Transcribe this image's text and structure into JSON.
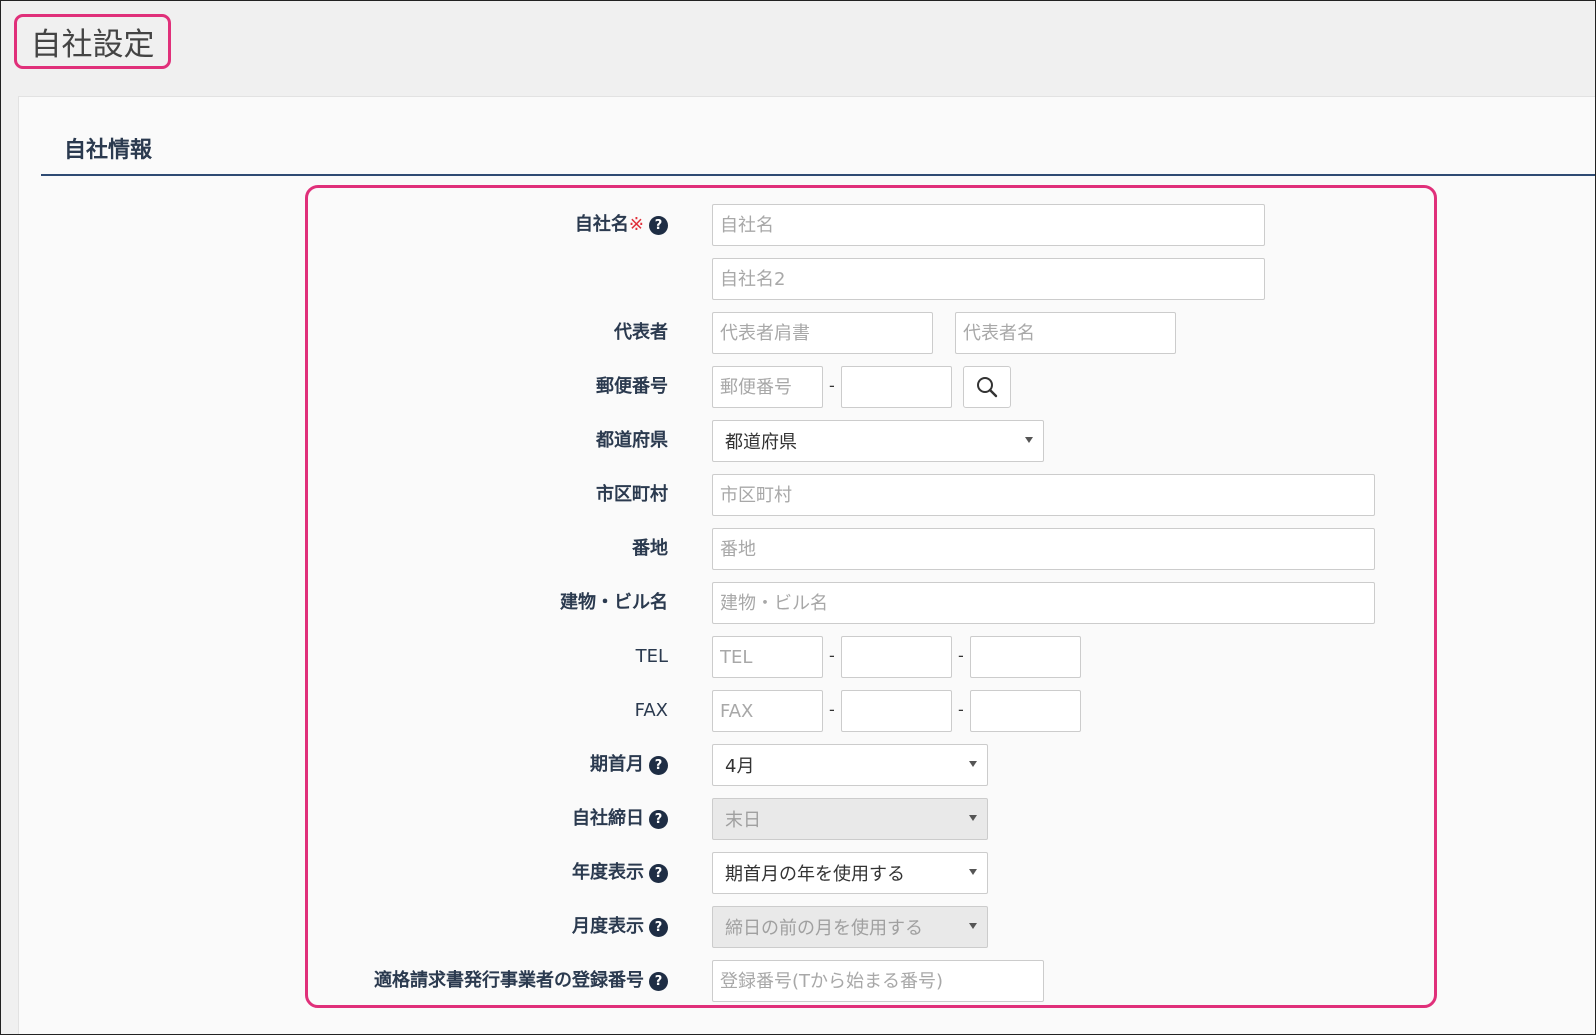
{
  "page": {
    "title": "自社設定"
  },
  "section": {
    "title": "自社情報"
  },
  "form": {
    "company_name": {
      "label": "自社名",
      "required_mark": "※",
      "placeholder": "自社名",
      "placeholder2": "自社名2"
    },
    "representative": {
      "label": "代表者",
      "title_placeholder": "代表者肩書",
      "name_placeholder": "代表者名"
    },
    "postal": {
      "label": "郵便番号",
      "placeholder": "郵便番号",
      "separator": "-"
    },
    "prefecture": {
      "label": "都道府県",
      "value": "都道府県"
    },
    "city": {
      "label": "市区町村",
      "placeholder": "市区町村"
    },
    "address": {
      "label": "番地",
      "placeholder": "番地"
    },
    "building": {
      "label": "建物・ビル名",
      "placeholder": "建物・ビル名"
    },
    "tel": {
      "label": "TEL",
      "placeholder": "TEL",
      "separator": "-"
    },
    "fax": {
      "label": "FAX",
      "placeholder": "FAX",
      "separator": "-"
    },
    "fiscal_start_month": {
      "label": "期首月",
      "value": "4月"
    },
    "closing_day": {
      "label": "自社締日",
      "value": "末日",
      "disabled": true
    },
    "year_display": {
      "label": "年度表示",
      "value": "期首月の年を使用する"
    },
    "month_display": {
      "label": "月度表示",
      "value": "締日の前の月を使用する",
      "disabled": true
    },
    "invoice_registration": {
      "label": "適格請求書発行事業者の登録番号",
      "placeholder": "登録番号(Tから始まる番号)"
    }
  },
  "icons": {
    "help": "question-circle-icon",
    "search": "search-icon",
    "dropdown": "caret-down-icon"
  },
  "colors": {
    "highlight": "#e0307a",
    "label_text": "#2b3a4f",
    "rule": "#2e4a73",
    "required": "#e0303a"
  }
}
